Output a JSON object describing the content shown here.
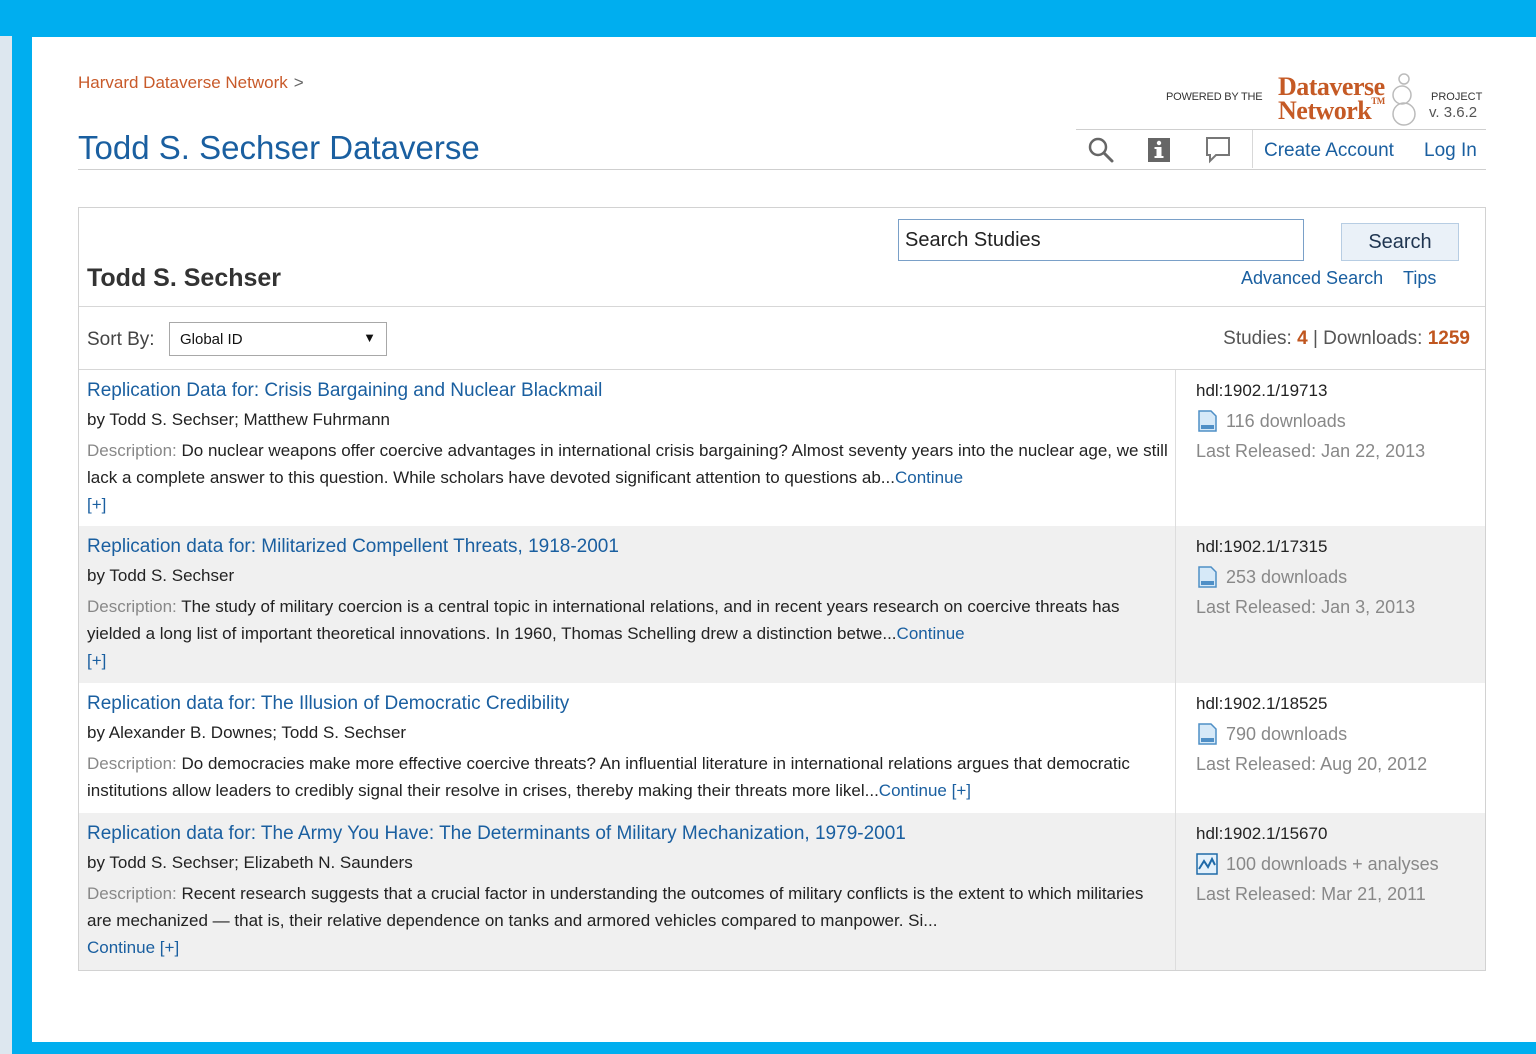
{
  "breadcrumb": {
    "network": "Harvard Dataverse Network",
    "separator": ">"
  },
  "page_title": "Todd S. Sechser Dataverse",
  "powered_by": {
    "prefix": "POWERED BY THE",
    "logo_line1": "Dataverse",
    "logo_line2": "Network",
    "trademark": "TM",
    "project": "PROJECT",
    "version": "v. 3.6.2"
  },
  "toolbar": {
    "icons": [
      "search-icon",
      "info-icon",
      "comment-icon"
    ],
    "create_account": "Create Account",
    "log_in": "Log In"
  },
  "panel": {
    "name": "Todd S. Sechser",
    "search": {
      "value": "Search Studies",
      "button": "Search",
      "advanced": "Advanced Search",
      "tips": "Tips"
    },
    "sort": {
      "label": "Sort By:",
      "selected": "Global ID"
    },
    "stats": {
      "studies_label": "Studies:",
      "studies": "4",
      "sep": "|",
      "downloads_label": "Downloads:",
      "downloads": "1259"
    }
  },
  "studies": [
    {
      "title": "Replication Data for: Crisis Bargaining and Nuclear Blackmail",
      "authors": "by Todd S. Sechser; Matthew Fuhrmann",
      "desc_label": "Description:",
      "desc": "Do nuclear weapons offer coercive advantages in international crisis bargaining? Almost seventy years into the nuclear age, we still lack a complete answer to this question. While scholars have devoted significant attention to questions ab...",
      "continue": "Continue",
      "expand": "[+]",
      "hdl": "hdl:1902.1/19713",
      "downloads": "116 downloads",
      "icon": "document-icon",
      "released": "Last Released: Jan 22, 2013"
    },
    {
      "title": "Replication data for: Militarized Compellent Threats, 1918-2001",
      "authors": "by Todd S. Sechser",
      "desc_label": "Description:",
      "desc": "The study of military coercion is a central topic in international relations, and in recent years research on coercive threats has yielded a long list of important theoretical innovations. In 1960, Thomas Schelling drew a distinction betwe...",
      "continue": "Continue",
      "expand": "[+]",
      "hdl": "hdl:1902.1/17315",
      "downloads": "253 downloads",
      "icon": "document-icon",
      "released": "Last Released: Jan 3, 2013"
    },
    {
      "title": "Replication data for: The Illusion of Democratic Credibility",
      "authors": "by Alexander B. Downes; Todd S. Sechser",
      "desc_label": "Description:",
      "desc": "Do democracies make more effective coercive threats? An influential literature in international relations argues that democratic institutions allow leaders to credibly signal their resolve in crises, thereby making their threats more likel...",
      "continue": "Continue",
      "expand": "[+]",
      "hdl": "hdl:1902.1/18525",
      "downloads": "790 downloads",
      "icon": "document-icon",
      "released": "Last Released: Aug 20, 2012"
    },
    {
      "title": "Replication data for: The Army You Have: The Determinants of Military Mechanization, 1979-2001",
      "authors": "by Todd S. Sechser; Elizabeth N. Saunders",
      "desc_label": "Description:",
      "desc": "Recent research suggests that a crucial factor in understanding the outcomes of military conflicts is the extent to which militaries are mechanized — that is, their relative dependence on tanks and armored vehicles compared to manpower. Si...",
      "continue": "Continue",
      "expand": "[+]",
      "hdl": "hdl:1902.1/15670",
      "downloads": "100 downloads + analyses",
      "icon": "chart-icon",
      "released": "Last Released: Mar 21, 2011"
    }
  ],
  "colors": {
    "frame": "#00aeef",
    "link": "#1a5fa0",
    "accent": "#c0561f",
    "alt_row": "#f0f0f0"
  }
}
